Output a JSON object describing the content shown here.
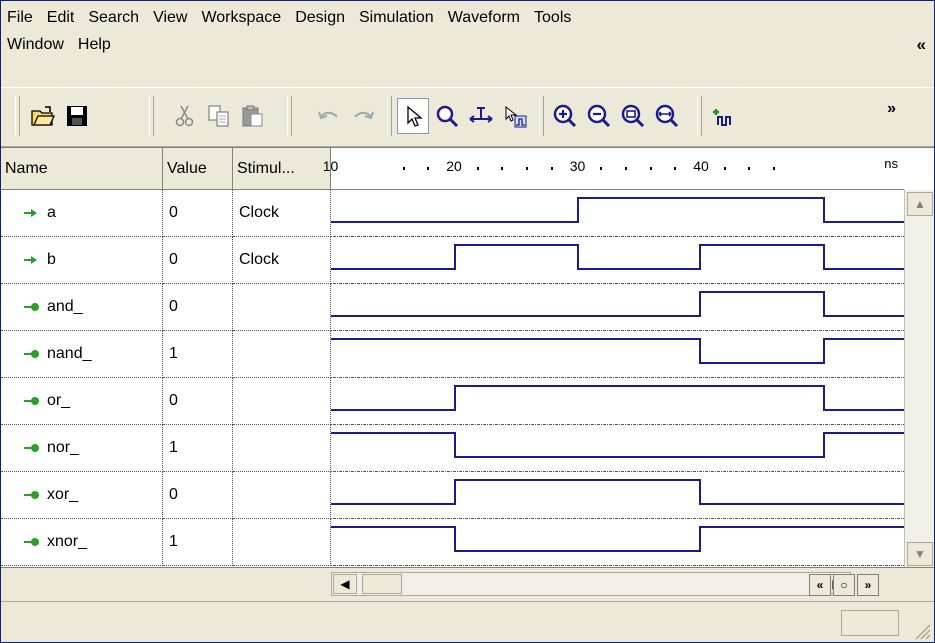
{
  "menu": {
    "row1": [
      "File",
      "Edit",
      "Search",
      "View",
      "Workspace",
      "Design",
      "Simulation",
      "Waveform",
      "Tools"
    ],
    "row2": [
      "Window",
      "Help"
    ],
    "collapse_glyph": "«"
  },
  "toolbar": {
    "icons": [
      "open-folder-icon",
      "save-icon",
      "cut-icon",
      "copy-icon",
      "paste-icon",
      "undo-icon",
      "redo-icon",
      "pointer-icon",
      "zoom-icon",
      "measure-icon",
      "select-range-icon",
      "zoom-in-icon",
      "zoom-out-icon",
      "zoom-fit-icon",
      "zoom-full-icon",
      "add-signal-icon"
    ],
    "more_glyph": "»"
  },
  "columns": {
    "name": "Name",
    "value": "Value",
    "stimulator": "Stimul..."
  },
  "timescale": {
    "labels": [
      "10",
      "20",
      "30",
      "40"
    ],
    "unit": "ns"
  },
  "signals": [
    {
      "name": "a",
      "value": "0",
      "stimulator": "Clock",
      "type": "input"
    },
    {
      "name": "b",
      "value": "0",
      "stimulator": "Clock",
      "type": "input"
    },
    {
      "name": "and_",
      "value": "0",
      "stimulator": "",
      "type": "output"
    },
    {
      "name": "nand_",
      "value": "1",
      "stimulator": "",
      "type": "output"
    },
    {
      "name": "or_",
      "value": "0",
      "stimulator": "",
      "type": "output"
    },
    {
      "name": "nor_",
      "value": "1",
      "stimulator": "",
      "type": "output"
    },
    {
      "name": "xor_",
      "value": "0",
      "stimulator": "",
      "type": "output"
    },
    {
      "name": "xnor_",
      "value": "1",
      "stimulator": "",
      "type": "output"
    }
  ],
  "colors": {
    "wave": "#1b1b8f",
    "input_icon": "#2aa02a",
    "output_icon": "#2aa02a"
  }
}
